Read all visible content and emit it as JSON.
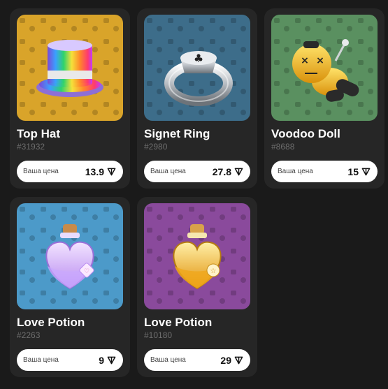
{
  "items": [
    {
      "name": "Top Hat",
      "number": "#31932",
      "price_label": "Ваша цена",
      "price": "13.9",
      "bg": "#d9a42a",
      "icon": "top-hat-icon"
    },
    {
      "name": "Signet Ring",
      "number": "#2980",
      "price_label": "Ваша цена",
      "price": "27.8",
      "bg": "#3d6d8a",
      "icon": "signet-ring-icon"
    },
    {
      "name": "Voodoo Doll",
      "number": "#8688",
      "price_label": "Ваша цена",
      "price": "15",
      "bg": "#5a9060",
      "icon": "voodoo-doll-icon"
    },
    {
      "name": "Love Potion",
      "number": "#2263",
      "price_label": "Ваша цена",
      "price": "9",
      "bg": "#4c9ac9",
      "icon": "love-potion-icon"
    },
    {
      "name": "Love Potion",
      "number": "#10180",
      "price_label": "Ваша цена",
      "price": "29",
      "bg": "#8a4a9c",
      "icon": "love-potion-icon"
    }
  ]
}
